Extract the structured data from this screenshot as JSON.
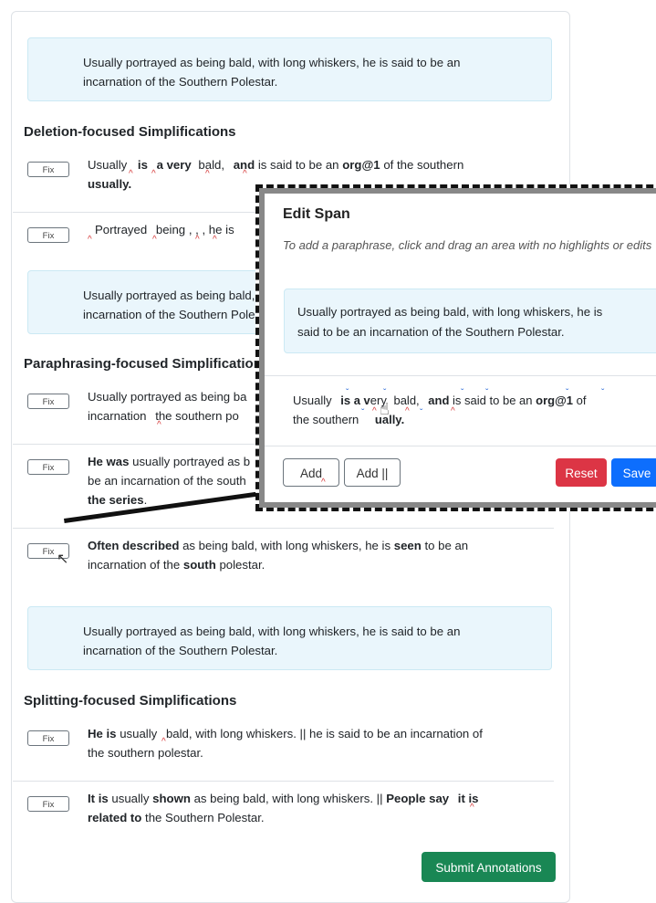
{
  "original_sentence": "Usually portrayed as being bald, with long whiskers, he is said to be an incarnation of the Southern Polestar.",
  "original_line1": "Usually portrayed as being bald, with long whiskers, he is said to be an",
  "original_line2": "incarnation of the Southern Polestar.",
  "sections": {
    "deletion": "Deletion-focused Simplifications",
    "paraphrasing": "Paraphrasing-focused Simplifications",
    "splitting": "Splitting-focused Simplifications"
  },
  "fix_label": "Fix",
  "simplifications": {
    "d1_l1_a": "Usually",
    "d1_l1_b": "is",
    "d1_l1_c": "a very",
    "d1_l1_d": "bald,",
    "d1_l1_e": "and",
    "d1_l1_f": "is said to be an",
    "d1_l1_g": "org@1",
    "d1_l1_h": "of the southern",
    "d1_l2": "usually.",
    "d2_a": "Portrayed",
    "d2_b": "being",
    "d2_c": ", ,",
    "d2_d": ", he is",
    "p1_l1": "Usually portrayed as being ba",
    "p1_l2": "incarnation",
    "p1_l2b": "the southern po",
    "p2_l1a": "He was",
    "p2_l1b": "usually portrayed as b",
    "p2_l2": "be an incarnation of the south",
    "p2_l3": "the series",
    "p3_l1a": "Often described",
    "p3_l1b": "as being bald, with long whiskers, he is",
    "p3_l1c": "seen",
    "p3_l1d": "to be an",
    "p3_l2a": "incarnation of the",
    "p3_l2b": "south",
    "p3_l2c": "polestar.",
    "s1_l1a": "He is",
    "s1_l1b": "usually",
    "s1_l1c": "bald, with long whiskers. || he is said to be an incarnation of",
    "s1_l2": "the southern polestar.",
    "s2_l1a": "It is",
    "s2_l1b": "usually",
    "s2_l1c": "shown",
    "s2_l1d": "as being bald, with long whiskers. ||",
    "s2_l1e": "People say",
    "s2_l1f": "it is",
    "s2_l2a": "related to",
    "s2_l2b": "the Southern Polestar."
  },
  "submit_label": "Submit Annotations",
  "popup": {
    "title": "Edit Span",
    "instructions": "To add a paraphrase, click and drag an area with no highlights or edits",
    "orig_line1": "Usually portrayed as being bald, with long whiskers, he is",
    "orig_line2": "said to be an incarnation of the Southern Polestar.",
    "simp_a": "Usually",
    "simp_b": "is a v",
    "simp_c": "ery",
    "simp_d": "bald,",
    "simp_e": "and",
    "simp_f": "is said to be an",
    "simp_g": "org@1",
    "simp_h": "of",
    "simp_l2a": "the southern",
    "simp_l2b": "ually.",
    "add_label": "Add",
    "add_bar_label": "Add ||",
    "reset_label": "Reset",
    "save_label": "Save"
  },
  "colors": {
    "deletion_caret": "#d63a3a",
    "paraphrase_caret": "#2a6bd8",
    "submit": "#198754",
    "reset": "#dc3545",
    "save": "#0d6efd"
  }
}
